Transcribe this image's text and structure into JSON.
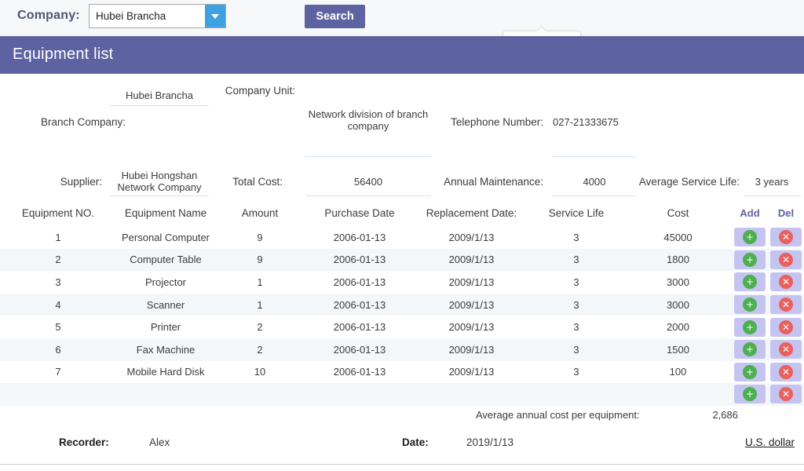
{
  "topbar": {
    "company_label": "Company:",
    "company_selected": "Hubei  Brancha",
    "dropdown_icon": "chevron-down-icon",
    "search_label": "Search"
  },
  "header": {
    "title": "Equipment list",
    "accent_color": "#5d63a0"
  },
  "form": {
    "branch_company_label": "Branch Company:",
    "branch_company_value": "Hubei  Brancha",
    "company_unit_label": "Company Unit:",
    "company_unit_value": "Network division of branch company",
    "telephone_label": "Telephone Number:",
    "telephone_value": "027-21333675",
    "supplier_label": "Supplier:",
    "supplier_value": "Hubei Hongshan Network Company",
    "total_cost_label": "Total Cost:",
    "total_cost_value": "56400",
    "annual_maintenance_label": "Annual Maintenance:",
    "annual_maintenance_value": "4000",
    "average_service_life_label": "Average Service Life:",
    "average_service_life_value": "3 years",
    "focused_input_value": ""
  },
  "table": {
    "columns": [
      "Equipment NO.",
      "Equipment Name",
      "Amount",
      "Purchase Date",
      "Replacement Date:",
      "Service Life",
      "Cost",
      "Add",
      "Del"
    ],
    "add_icon": "plus-circle-icon",
    "del_icon": "close-circle-icon",
    "add_glyph": "+",
    "del_glyph": "✕",
    "rows": [
      {
        "no": "1",
        "name": "Personal Computer",
        "amount": "9",
        "purchase": "2006-01-13",
        "replacement": "2009/1/13",
        "life": "3",
        "cost": "45000"
      },
      {
        "no": "2",
        "name": "Computer Table",
        "amount": "9",
        "purchase": "2006-01-13",
        "replacement": "2009/1/13",
        "life": "3",
        "cost": "1800"
      },
      {
        "no": "3",
        "name": "Projector",
        "amount": "1",
        "purchase": "2006-01-13",
        "replacement": "2009/1/13",
        "life": "3",
        "cost": "3000"
      },
      {
        "no": "4",
        "name": "Scanner",
        "amount": "1",
        "purchase": "2006-01-13",
        "replacement": "2009/1/13",
        "life": "3",
        "cost": "3000"
      },
      {
        "no": "5",
        "name": "Printer",
        "amount": "2",
        "purchase": "2006-01-13",
        "replacement": "2009/1/13",
        "life": "3",
        "cost": "2000"
      },
      {
        "no": "6",
        "name": "Fax Machine",
        "amount": "2",
        "purchase": "2006-01-13",
        "replacement": "2009/1/13",
        "life": "3",
        "cost": "1500"
      },
      {
        "no": "7",
        "name": "Mobile Hard Disk",
        "amount": "10",
        "purchase": "2006-01-13",
        "replacement": "2009/1/13",
        "life": "3",
        "cost": "100"
      },
      {
        "no": "",
        "name": "",
        "amount": "",
        "purchase": "",
        "replacement": "",
        "life": "",
        "cost": ""
      }
    ]
  },
  "summary": {
    "average_annual_cost_label": "Average annual cost per equipment:",
    "average_annual_cost_value": "2,686"
  },
  "footer": {
    "recorder_label": "Recorder:",
    "recorder_value": "Alex",
    "date_label": "Date:",
    "date_value": "2019/1/13",
    "currency_link": "U.S. dollar"
  }
}
